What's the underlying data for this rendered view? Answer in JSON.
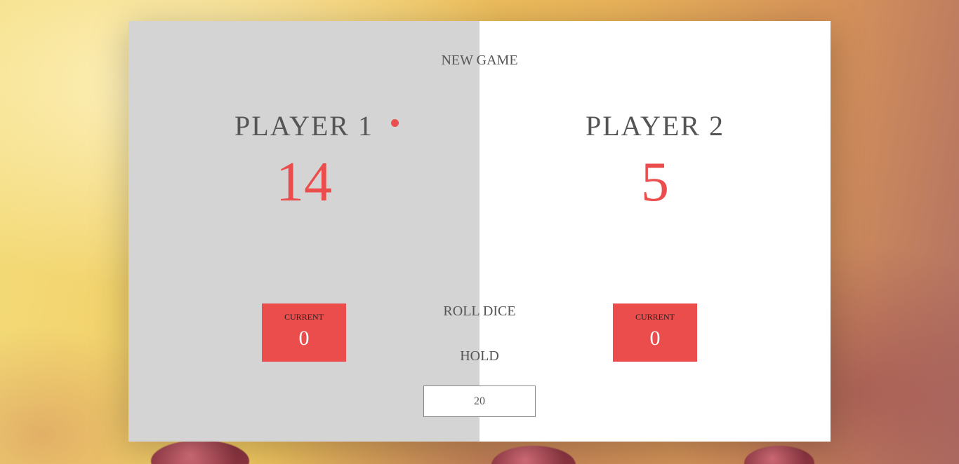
{
  "colors": {
    "accent": "#eb4d4d",
    "active_panel_bg": "#d4d4d4",
    "inactive_panel_bg": "#ffffff",
    "text": "#555555"
  },
  "game": {
    "new_game_label": "NEW GAME",
    "roll_dice_label": "ROLL DICE",
    "hold_label": "HOLD",
    "final_score_value": "20",
    "active_player": 1
  },
  "players": [
    {
      "name": "PLAYER 1",
      "score": "14",
      "current_label": "CURRENT",
      "current_score": "0"
    },
    {
      "name": "PLAYER 2",
      "score": "5",
      "current_label": "CURRENT",
      "current_score": "0"
    }
  ]
}
